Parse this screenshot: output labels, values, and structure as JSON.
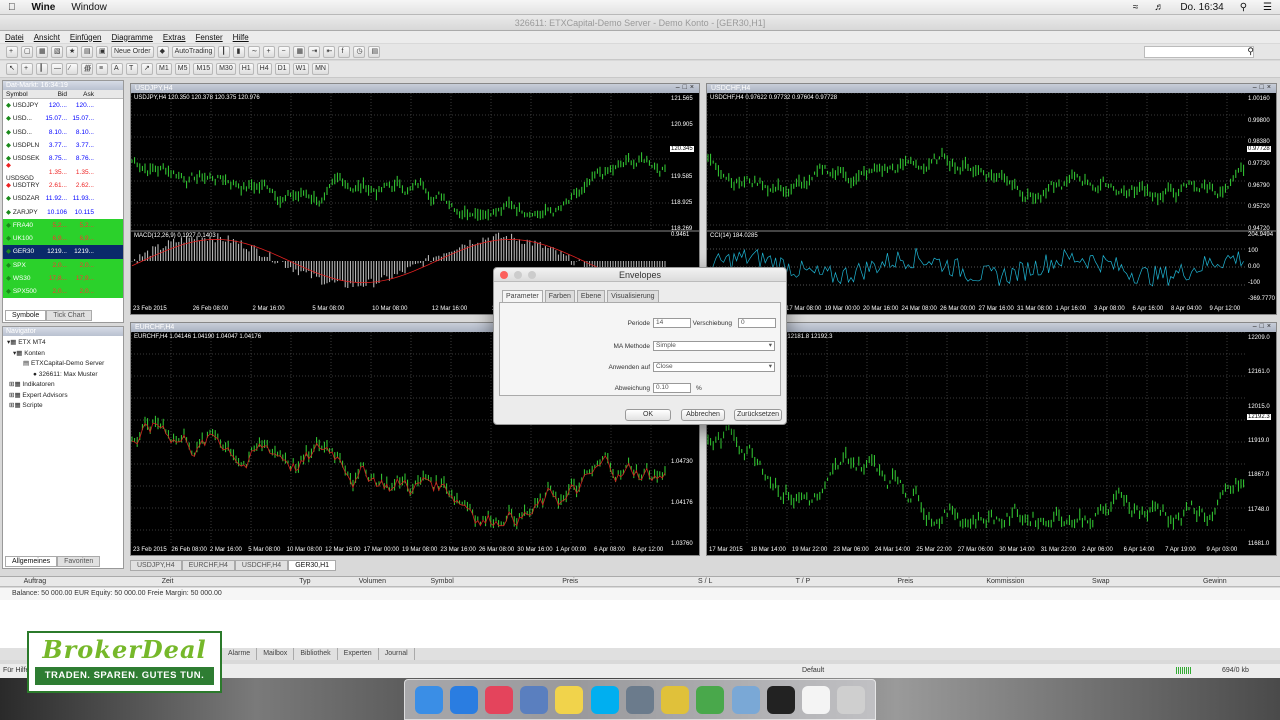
{
  "mac_menu": {
    "app": "Wine",
    "window": "Window",
    "clock": "Do. 16:34"
  },
  "window_title": "326611: ETXCapital-Demo Server - Demo Konto - [GER30,H1]",
  "menu": [
    "Datei",
    "Ansicht",
    "Einfügen",
    "Diagramme",
    "Extras",
    "Fenster",
    "Hilfe"
  ],
  "toolbar": {
    "new_order": "Neue Order",
    "autotrading": "AutoTrading",
    "timeframes": [
      "M1",
      "M5",
      "M15",
      "M30",
      "H1",
      "H4",
      "D1",
      "W1",
      "MN"
    ]
  },
  "market_watch": {
    "title": "Dat-Markt: 16:34:19",
    "headers": [
      "Symbol",
      "Bid",
      "Ask"
    ],
    "rows": [
      [
        "USDJPY",
        "120....",
        "120...."
      ],
      [
        "USD...",
        "15.07...",
        "15.07..."
      ],
      [
        "USD...",
        "8.10...",
        "8.10..."
      ],
      [
        "USDPLN",
        "3.77...",
        "3.77..."
      ],
      [
        "USDSEK",
        "8.75...",
        "8.76..."
      ],
      [
        "USDSGD",
        "1.35...",
        "1.35..."
      ],
      [
        "USDTRY",
        "2.61...",
        "2.62..."
      ],
      [
        "USDZAR",
        "11.92...",
        "11.93..."
      ],
      [
        "ZARJPY",
        "10.106",
        "10.115"
      ],
      [
        "FRA40",
        "5,2...",
        "5,2..."
      ],
      [
        "UK100",
        "6,9...",
        "6,9..."
      ],
      [
        "GER30",
        "1219...",
        "1219..."
      ],
      [
        "SPX",
        "2,0...",
        "2,0..."
      ],
      [
        "WS30",
        "17,8...",
        "17,9..."
      ],
      [
        "SPX500",
        "2,0...",
        "2,0..."
      ]
    ],
    "tabs": [
      "Symbole",
      "Tick Chart"
    ]
  },
  "navigator": {
    "title": "Navigator",
    "items": [
      "ETX MT4",
      "Konten",
      "ETXCapital-Demo Server",
      "326611: Max Muster",
      "Indikatoren",
      "Expert Advisors",
      "Scripte"
    ],
    "tabs": [
      "Allgemeines",
      "Favoriten"
    ]
  },
  "charts": [
    {
      "title": "USDJPY,H4",
      "info": "USDJPY,H4  120.350 120.378 120.375 120.976",
      "sub": "MACD(12,26,9) 0.1927 0.1403",
      "yticks": [
        "121.565",
        "120.905",
        "120.245",
        "119.585",
        "118.925",
        "118.269"
      ],
      "price_tag": "120.345",
      "sub_ticks": [
        "0.9461"
      ],
      "times": [
        "23 Feb 2015",
        "26 Feb 08:00",
        "2 Mar 16:00",
        "5 Mar 08:00",
        "10 Mar 08:00",
        "12 Mar 16:00",
        "17 Mar 00:00",
        "19 Mar 08:00",
        "23 Mar 16:00"
      ]
    },
    {
      "title": "USDCHF,H4",
      "info": "USDCHF,H4  0.97622 0.97732 0.97604 0.97728",
      "sub": "CCI(14) 184.0285",
      "yticks": [
        "1.00160",
        "0.99800",
        "0.98380",
        "0.97730",
        "0.96790",
        "0.95720",
        "0.94720"
      ],
      "price_tag": "0.97728",
      "sub_ticks": [
        "204.9494",
        "100",
        "0.00",
        "-100",
        "-369.7770"
      ],
      "times": [
        "12 Mar 2015",
        "13 Mar 16:00",
        "17 Mar 08:00",
        "19 Mar 00:00",
        "20 Mar 16:00",
        "24 Mar 08:00",
        "26 Mar 00:00",
        "27 Mar 16:00",
        "31 Mar 08:00",
        "1 Apr 16:00",
        "3 Apr 08:00",
        "6 Apr 16:00",
        "8 Apr 04:00",
        "9 Apr 12:00"
      ]
    },
    {
      "title": "EURCHF,H4",
      "info": "EURCHF,H4  1.04146 1.04190 1.04047 1.04176",
      "yticks": [
        "1.06080",
        "1.05790",
        "1.05160",
        "1.04730",
        "1.04176",
        "1.03760"
      ],
      "price_tag": "1.04176",
      "times": [
        "23 Feb 2015",
        "26 Feb 08:00",
        "2 Mar 16:00",
        "5 Mar 08:00",
        "10 Mar 08:00",
        "12 Mar 16:00",
        "17 Mar 00:00",
        "19 Mar 08:00",
        "23 Mar 16:00",
        "26 Mar 08:00",
        "30 Mar 16:00",
        "1 Apr 00:00",
        "6 Apr 08:00",
        "8 Apr 12:00"
      ]
    },
    {
      "title": "GER30,H1",
      "info": "GER30,H1  12181.3 12195.0 12181.8 12192.3",
      "yticks": [
        "12209.0",
        "12161.0",
        "12015.0",
        "11919.0",
        "11867.0",
        "11748.0",
        "11681.0"
      ],
      "price_tag": "12192.3",
      "times": [
        "17 Mar 2015",
        "18 Mar 14:00",
        "19 Mar 22:00",
        "23 Mar 06:00",
        "24 Mar 14:00",
        "25 Mar 22:00",
        "27 Mar 06:00",
        "30 Mar 14:00",
        "31 Mar 22:00",
        "2 Apr 06:00",
        "6 Apr 14:00",
        "7 Apr 19:00",
        "9 Apr 03:00"
      ]
    }
  ],
  "chart_tabs": [
    "USDJPY,H4",
    "EURCHF,H4",
    "USDCHF,H4",
    "GER30,H1"
  ],
  "dialog": {
    "title": "Envelopes",
    "tabs": [
      "Parameter",
      "Farben",
      "Ebene",
      "Visualisierung"
    ],
    "fields": {
      "periode_label": "Periode",
      "periode": "14",
      "verschiebung_label": "Verschiebung",
      "verschiebung": "0",
      "methode_label": "MA Methode",
      "methode": "Simple",
      "anwenden_label": "Anwenden auf",
      "anwenden": "Close",
      "abweichung_label": "Abweichung",
      "abweichung": "0.10",
      "percent": "%"
    },
    "buttons": {
      "ok": "OK",
      "cancel": "Abbrechen",
      "reset": "Zurücksetzen"
    }
  },
  "terminal": {
    "columns": [
      "Auftrag",
      "Zeit",
      "Typ",
      "Volumen",
      "Symbol",
      "Preis",
      "S / L",
      "T / P",
      "Preis",
      "Kommission",
      "Swap",
      "Gewinn"
    ],
    "balance": "Balance: 50 000.00 EUR  Equity: 50 000.00  Freie Margin: 50 000.00",
    "tabs": [
      "Alarme",
      "Mailbox",
      "Bibliothek",
      "Experten",
      "Journal"
    ]
  },
  "status": {
    "left": "Für Hilfe",
    "profile": "Default",
    "traffic": "694/0 kb"
  },
  "brand": {
    "name": "BrokerDeal",
    "claim": "TRADEN. SPAREN. GUTES TUN."
  },
  "dock": [
    "Finder",
    "Safari",
    "iTunes",
    "Xcode",
    "Notes",
    "Skype",
    "Preview",
    "Chrome",
    "Maps",
    "Mail",
    "Terminal",
    "Doc",
    "Trash"
  ]
}
